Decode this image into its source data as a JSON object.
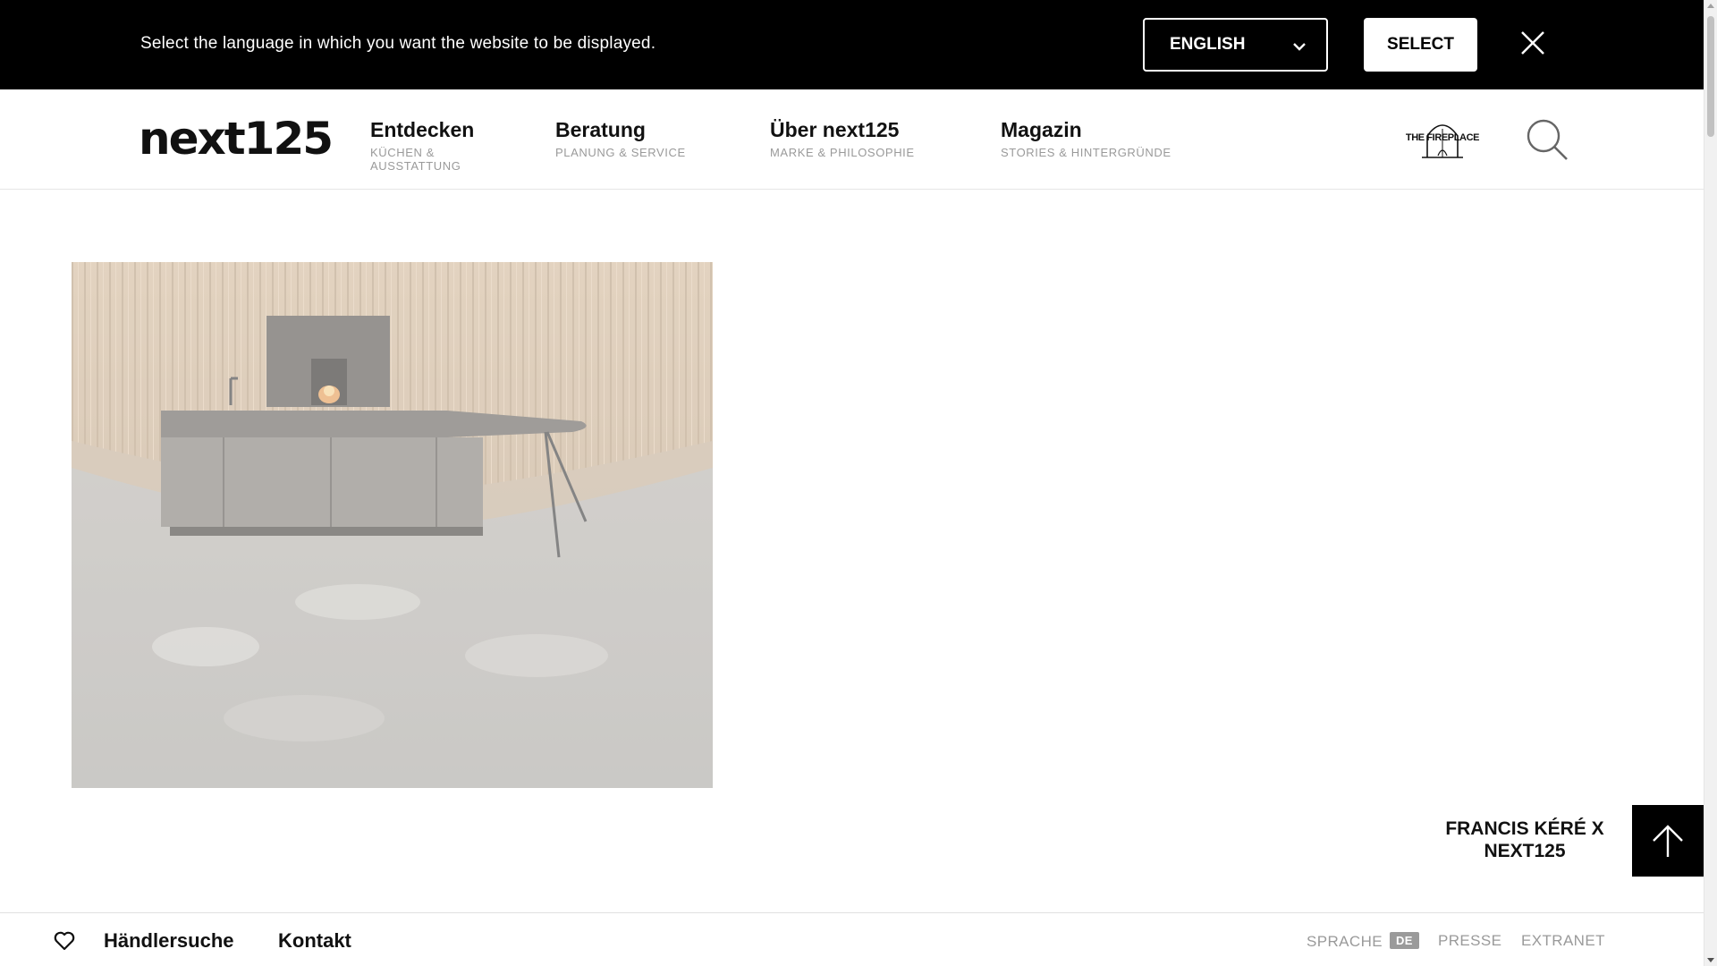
{
  "language_bar": {
    "message": "Select the language in which you want the website to be displayed.",
    "selected_language": "ENGLISH",
    "select_label": "SELECT",
    "chevron_icon": "chevron-down-icon",
    "close_icon": "close-icon"
  },
  "header": {
    "logo": "next125",
    "nav": [
      {
        "title": "Entdecken",
        "subtitle": "KÜCHEN & AUSSTATTUNG"
      },
      {
        "title": "Beratung",
        "subtitle": "PLANUNG & SERVICE"
      },
      {
        "title": "Über next125",
        "subtitle": "MARKE & PHILOSOPHIE"
      },
      {
        "title": "Magazin",
        "subtitle": "STORIES & HINTERGRÜNDE"
      }
    ],
    "partner_logo_text": "THE FIREPLACE",
    "search_icon": "search-icon"
  },
  "main": {
    "caption": "FRANCIS KÉRÉ X NEXT125",
    "back_to_top_icon": "arrow-up-icon"
  },
  "footer": {
    "wishlist_icon": "heart-icon",
    "dealer_search": "Händlersuche",
    "contact": "Kontakt",
    "language_label": "SPRACHE",
    "language_code": "DE",
    "press": "PRESSE",
    "extranet": "EXTRANET"
  },
  "colors": {
    "bar_background": "#000000",
    "muted_text": "#9a9a9a",
    "accent": "#111111"
  }
}
